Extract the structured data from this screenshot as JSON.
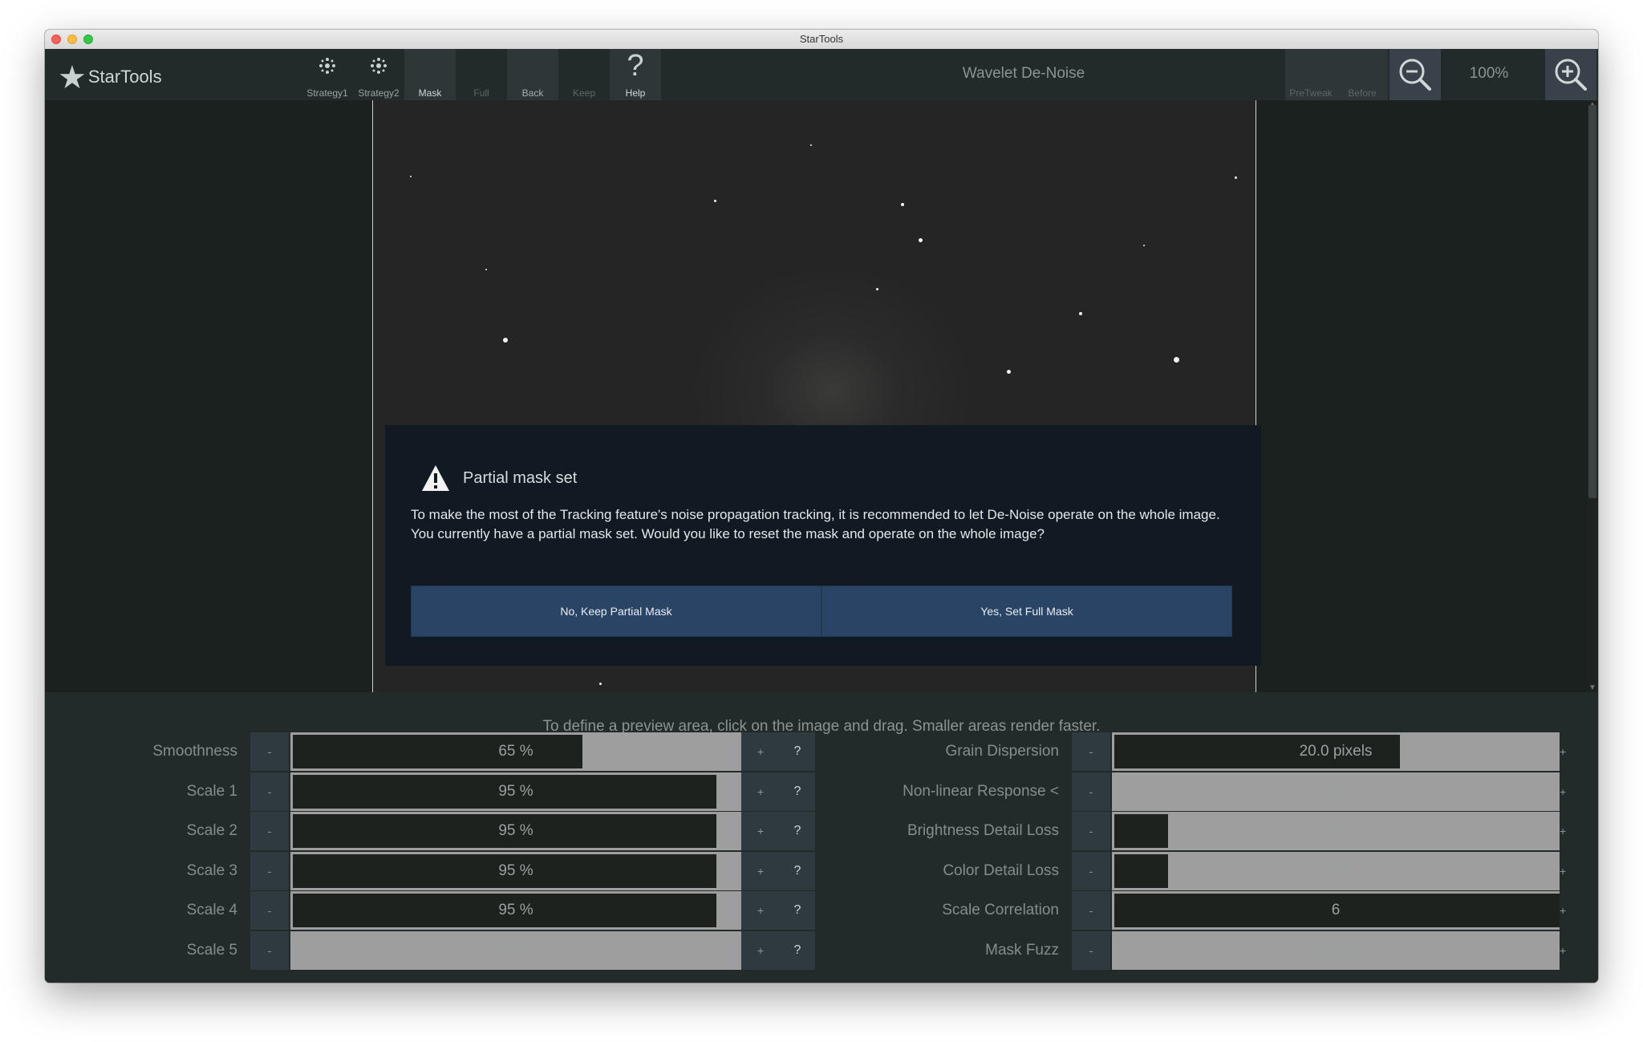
{
  "window": {
    "title": "StarTools"
  },
  "app": {
    "logo_text": "StarTools"
  },
  "toolbar": {
    "strategy1": "Strategy1",
    "strategy2": "Strategy2",
    "mask": "Mask",
    "full": "Full",
    "back": "Back",
    "keep": "Keep",
    "help": "Help",
    "tool_title": "Wavelet De-Noise",
    "pretweak": "PreTweak",
    "before": "Before",
    "zoom_level": "100%"
  },
  "dialog": {
    "title": "Partial mask set",
    "message": "To make the most of the Tracking feature's noise propagation tracking, it is recommended to let De-Noise operate on the whole image. You currently have a partial mask set. Would you like to reset the mask and operate on the whole image?",
    "no_button": "No, Keep Partial Mask",
    "yes_button": "Yes, Set Full Mask"
  },
  "panel": {
    "hint": "To define a preview area, click on the image and drag. Smaller areas render faster.",
    "minus": "-",
    "plus": "+",
    "help": "?",
    "left_params": [
      {
        "label": "Smoothness",
        "value": "65 %",
        "fill": 0.65
      },
      {
        "label": "Scale 1",
        "value": "95 %",
        "fill": 0.95
      },
      {
        "label": "Scale 2",
        "value": "95 %",
        "fill": 0.95
      },
      {
        "label": "Scale 3",
        "value": "95 %",
        "fill": 0.95
      },
      {
        "label": "Scale 4",
        "value": "95 %",
        "fill": 0.95
      },
      {
        "label": "Scale 5",
        "value": "0 %",
        "fill": 0.0
      }
    ],
    "right_params": [
      {
        "label": "Grain Dispersion",
        "value": "20.0 pixels",
        "fill": 0.64
      },
      {
        "label": "Non-linear Response <",
        "value": "Off",
        "fill": 0.0
      },
      {
        "label": "Brightness Detail Loss",
        "value": "12 %",
        "fill": 0.12
      },
      {
        "label": "Color Detail Loss",
        "value": "12 %",
        "fill": 0.12
      },
      {
        "label": "Scale Correlation",
        "value": "6",
        "fill": 1.0
      },
      {
        "label": "Mask Fuzz",
        "value": "1.0 pixels",
        "fill": 0.0
      }
    ]
  },
  "colors": {
    "background": "#1c2120",
    "toolbar": "#232a2a",
    "dialog": "#111a23",
    "dialog_button": "#2a4466",
    "slider_track": "#9e9e9e",
    "slider_fill": "#1d221f"
  }
}
